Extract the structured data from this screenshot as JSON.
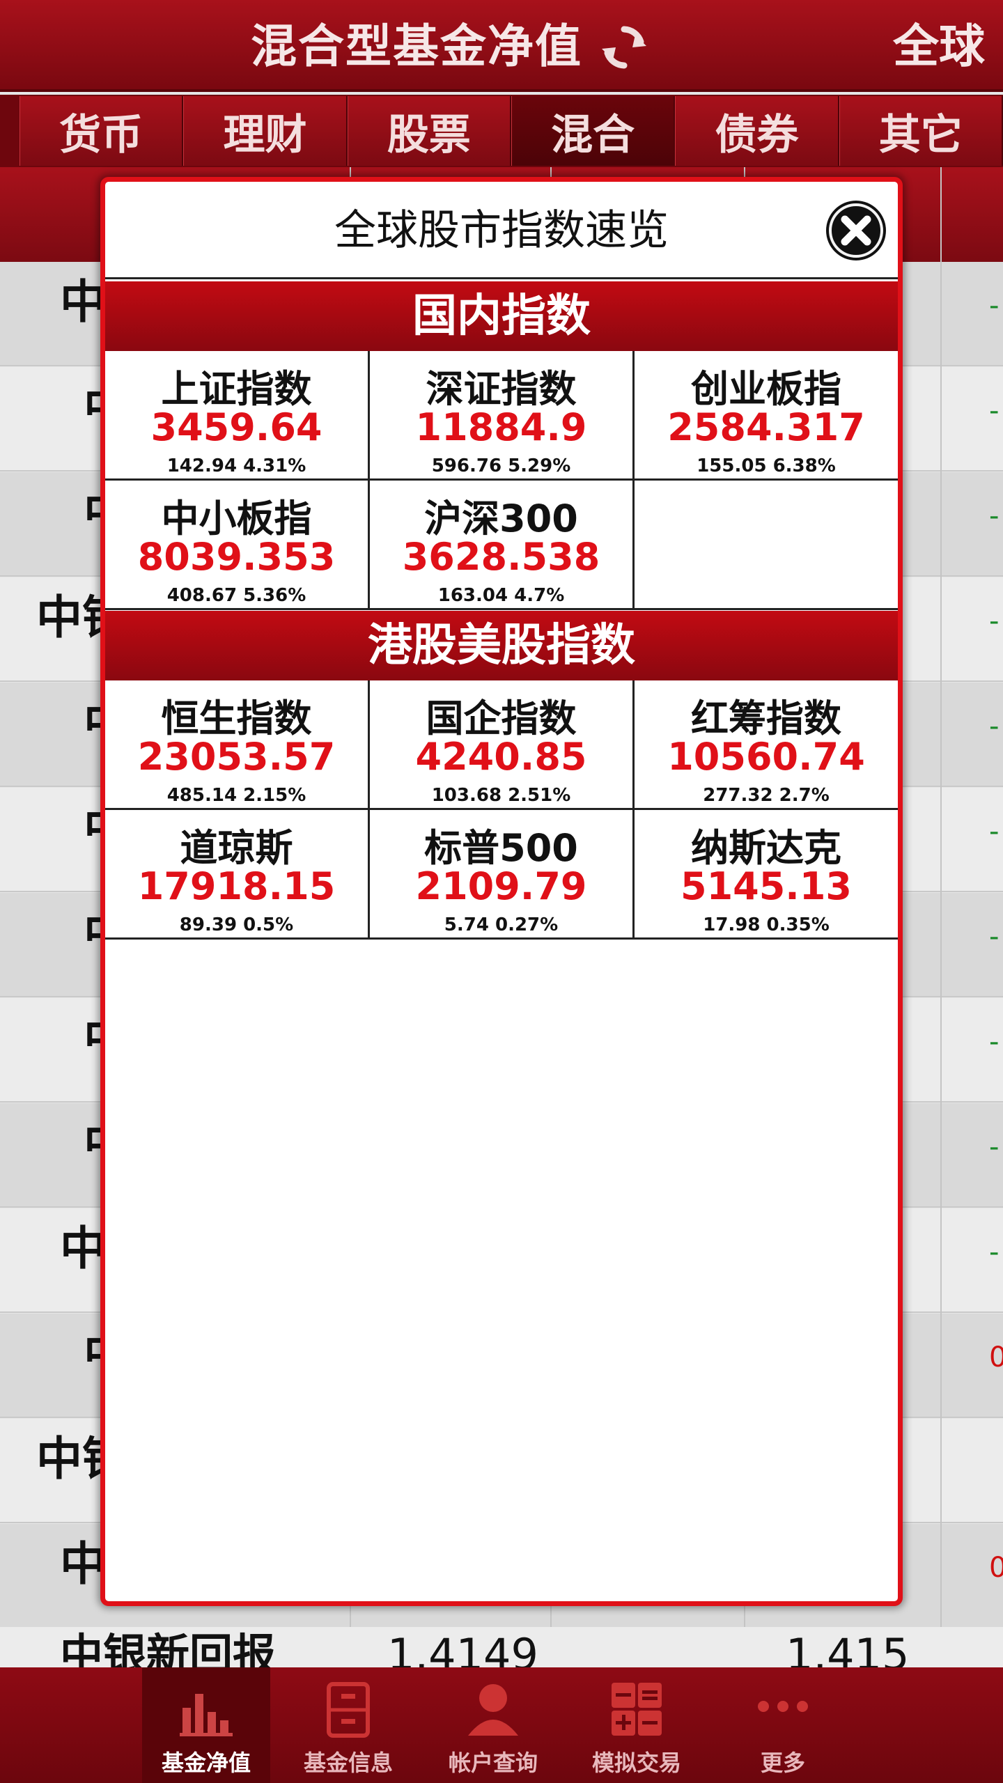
{
  "header": {
    "title": "混合型基金净值",
    "global_label": "全球"
  },
  "tabs": [
    {
      "label": "货币"
    },
    {
      "label": "理财"
    },
    {
      "label": "股票"
    },
    {
      "label": "混合",
      "active": true
    },
    {
      "label": "债券"
    },
    {
      "label": "其它"
    }
  ],
  "background_table": {
    "row_label_fragments": [
      "中",
      "中",
      "中",
      "中银",
      "中",
      "中",
      "中",
      "中",
      "中",
      "中",
      "中",
      "中银",
      "中"
    ],
    "right_values": [
      "-",
      "-",
      "-",
      "-",
      "-",
      "-",
      "-",
      "-",
      "-",
      "-",
      "0",
      "",
      "0"
    ],
    "last_row": {
      "name": "中银新回报",
      "nav": "1.4149",
      "acc_nav": "1.415"
    }
  },
  "dialog": {
    "title": "全球股市指数速览",
    "domestic": {
      "heading": "国内指数",
      "rows": [
        [
          {
            "name": "上证指数",
            "value": "3459.64",
            "change": "142.94 4.31%"
          },
          {
            "name": "深证指数",
            "value": "11884.9",
            "change": "596.76 5.29%"
          },
          {
            "name": "创业板指",
            "value": "2584.317",
            "change": "155.05 6.38%"
          }
        ],
        [
          {
            "name": "中小板指",
            "value": "8039.353",
            "change": "408.67 5.36%"
          },
          {
            "name": "沪深300",
            "value": "3628.538",
            "change": "163.04 4.7%"
          },
          {
            "name": "",
            "value": "",
            "change": ""
          }
        ]
      ]
    },
    "foreign": {
      "heading": "港股美股指数",
      "rows": [
        [
          {
            "name": "恒生指数",
            "value": "23053.57",
            "change": "485.14 2.15%"
          },
          {
            "name": "国企指数",
            "value": "4240.85",
            "change": "103.68 2.51%"
          },
          {
            "name": "红筹指数",
            "value": "10560.74",
            "change": "277.32 2.7%"
          }
        ],
        [
          {
            "name": "道琼斯",
            "value": "17918.15",
            "change": "89.39 0.5%"
          },
          {
            "name": "标普500",
            "value": "2109.79",
            "change": "5.74 0.27%"
          },
          {
            "name": "纳斯达克",
            "value": "5145.13",
            "change": "17.98 0.35%"
          }
        ]
      ]
    }
  },
  "bottom_nav": [
    {
      "label": "基金净值",
      "icon": "bar-chart-icon",
      "active": true
    },
    {
      "label": "基金信息",
      "icon": "file-cabinet-icon"
    },
    {
      "label": "帐户查询",
      "icon": "user-icon"
    },
    {
      "label": "模拟交易",
      "icon": "calculator-icon"
    },
    {
      "label": "更多",
      "icon": "more-dots-icon"
    }
  ],
  "colors": {
    "brand_red": "#a8111b",
    "value_red": "#e01018",
    "down_green": "#1a8a2a"
  }
}
